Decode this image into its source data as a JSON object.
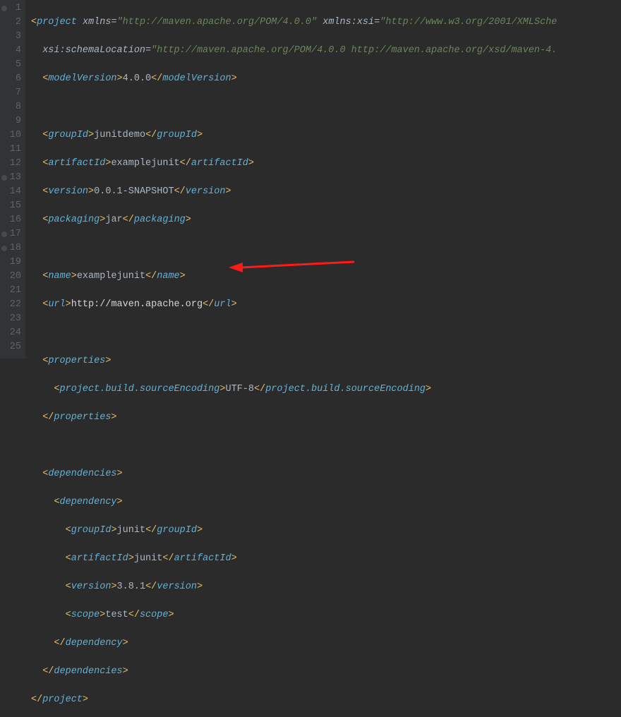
{
  "gutter": {
    "lines": [
      "1",
      "2",
      "3",
      "4",
      "5",
      "6",
      "7",
      "8",
      "9",
      "10",
      "11",
      "12",
      "13",
      "14",
      "15",
      "16",
      "17",
      "18",
      "19",
      "20",
      "21",
      "22",
      "23",
      "24",
      "25"
    ],
    "foldable": [
      0,
      12,
      16,
      17
    ]
  },
  "xml": {
    "projectOpen": "project",
    "xmlnsAttr": "xmlns",
    "xmlnsVal": "\"http://maven.apache.org/POM/4.0.0\"",
    "xsiAttr": "xmlns:xsi",
    "xsiVal": "\"http://www.w3.org/2001/XMLSche",
    "schemaLocAttr": "xsi:schemaLocation",
    "schemaLocVal": "\"http://maven.apache.org/POM/4.0.0 http://maven.apache.org/xsd/maven-4.",
    "modelVersionTag": "modelVersion",
    "modelVersionVal": "4.0.0",
    "groupIdTag": "groupId",
    "groupIdVal": "junitdemo",
    "artifactIdTag": "artifactId",
    "artifactIdVal": "examplejunit",
    "versionTag": "version",
    "versionVal": "0.0.1-SNAPSHOT",
    "packagingTag": "packaging",
    "packagingVal": "jar",
    "nameTag": "name",
    "nameVal": "examplejunit",
    "urlTag": "url",
    "urlVal": "http://maven.apache.org",
    "propertiesTag": "properties",
    "encodingTag": "project.build.sourceEncoding",
    "encodingVal": "UTF-8",
    "dependenciesTag": "dependencies",
    "dependencyTag": "dependency",
    "depGroupIdVal": "junit",
    "depArtifactIdVal": "junit",
    "depVersionVal": "3.8.1",
    "scopeTag": "scope",
    "scopeVal": "test"
  }
}
